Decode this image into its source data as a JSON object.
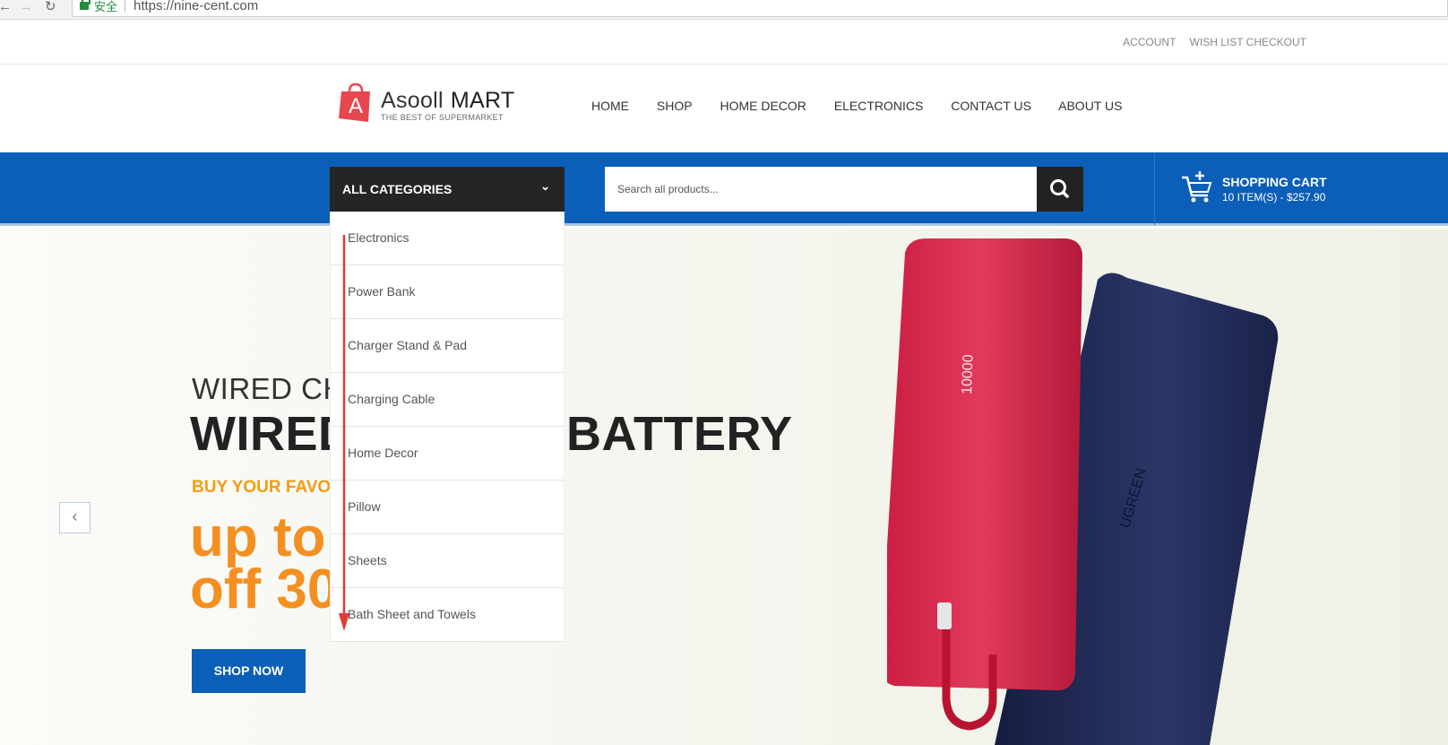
{
  "browser": {
    "secure_label": "安全",
    "url": "https://nine-cent.com"
  },
  "top_links": {
    "account": "ACCOUNT",
    "wishlist_checkout": "WISH LIST CHECKOUT"
  },
  "logo": {
    "name": "Asooll",
    "name2": "MART",
    "tagline": "THE BEST OF SUPERMARKET",
    "letter": "A"
  },
  "nav": [
    "HOME",
    "SHOP",
    "HOME DECOR",
    "ELECTRONICS",
    "CONTACT US",
    "ABOUT US"
  ],
  "categories": {
    "label": "ALL CATEGORIES",
    "items": [
      "Electronics",
      "Power Bank",
      "Charger Stand & Pad",
      "Charging Cable",
      "Home Decor",
      "Pillow",
      "Sheets",
      "Bath Sheet and Towels"
    ]
  },
  "search": {
    "placeholder": "Search all products..."
  },
  "cart": {
    "title": "SHOPPING CART",
    "summary": "10 ITEM(S) - $257.90"
  },
  "hero": {
    "line1": "WIRED CH",
    "line2": "WIRED POWER BATTERY",
    "line3": "BUY YOUR FAVO",
    "line4": "up to",
    "line5": "off 30",
    "cta": "SHOP NOW",
    "product_text": "10000",
    "product_brand": "UGREEN"
  },
  "colors": {
    "primary_blue": "#0c5fb8",
    "dark": "#252525",
    "orange": "#f39020",
    "product_red": "#d8284d",
    "product_navy": "#1f2a55",
    "annotation_red": "#e53935"
  }
}
